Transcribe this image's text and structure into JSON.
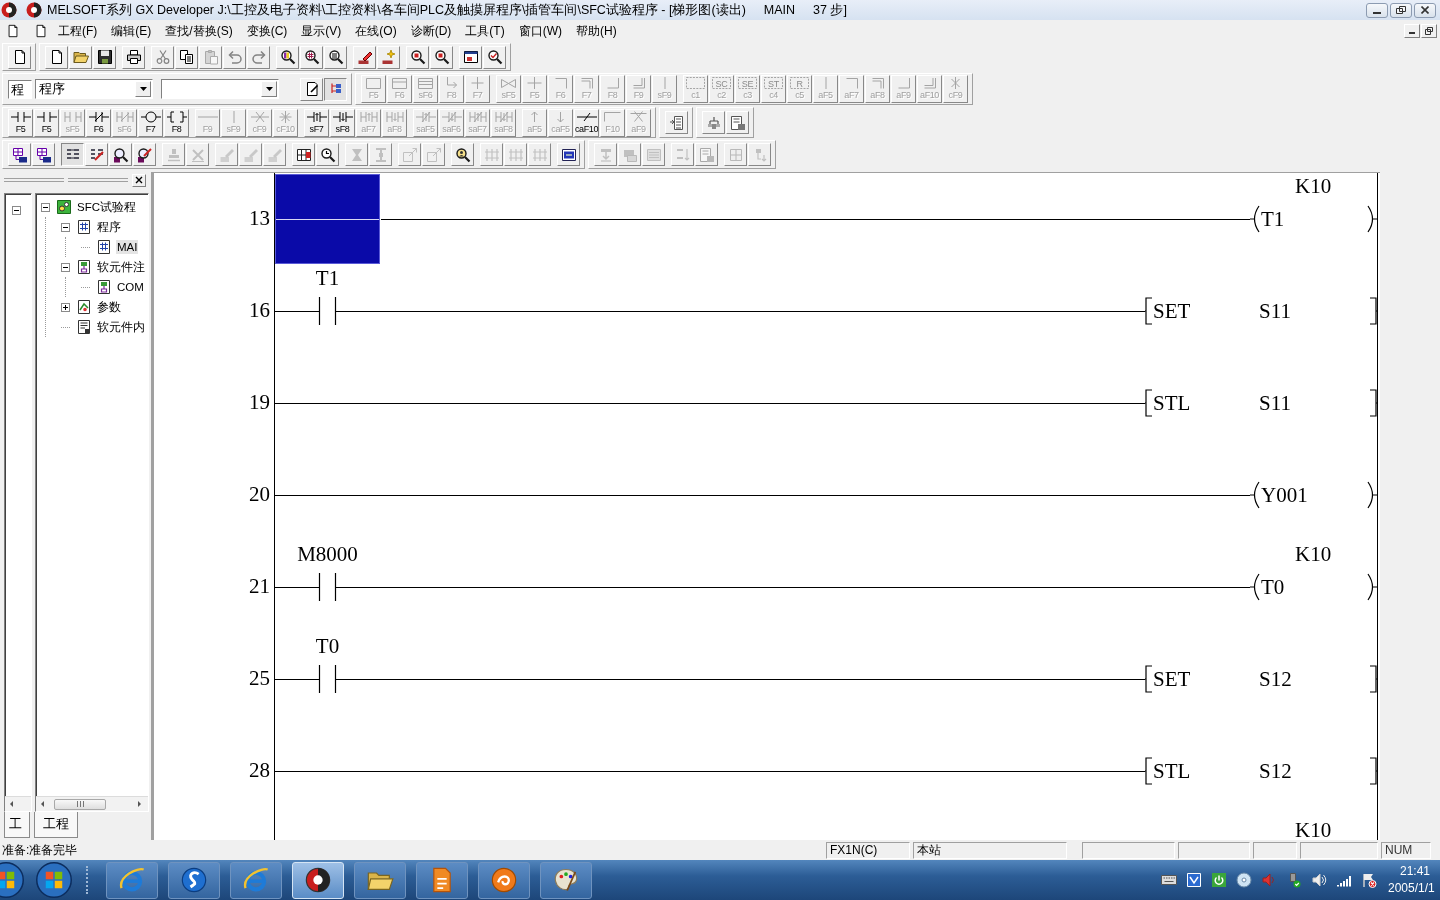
{
  "window": {
    "title": "MELSOFT系列 GX Developer J:\\工控及电子资料\\工控资料\\各车间PLC及触摸屏程序\\插管车间\\SFC试验程序 - [梯形图(读出)",
    "program": "MAIN",
    "steps": "37 步]"
  },
  "menu": [
    "工程(F)",
    "编辑(E)",
    "查找/替换(S)",
    "变换(C)",
    "显示(V)",
    "在线(O)",
    "诊断(D)",
    "工具(T)",
    "窗口(W)",
    "帮助(H)"
  ],
  "standard_toolbar": [
    [
      [
        {
          "kind": "tool",
          "disabled": false
        }
      ]
    ],
    [
      [
        {
          "kind": "tool",
          "disabled": false
        },
        {
          "kind": "tool",
          "disabled": false
        },
        {
          "kind": "tool",
          "disabled": false
        }
      ],
      [
        {
          "kind": "tool",
          "disabled": false
        }
      ],
      [
        {
          "kind": "tool",
          "disabled": true
        },
        {
          "kind": "tool",
          "disabled": false
        },
        {
          "kind": "tool",
          "disabled": true
        },
        {
          "kind": "tool",
          "disabled": true
        },
        {
          "kind": "tool",
          "disabled": true
        }
      ],
      [
        {
          "kind": "tool",
          "disabled": false
        },
        {
          "kind": "tool",
          "disabled": false
        },
        {
          "kind": "tool",
          "disabled": false
        }
      ],
      [
        {
          "kind": "tool",
          "disabled": false
        },
        {
          "kind": "tool",
          "disabled": false
        }
      ],
      [
        {
          "kind": "tool",
          "disabled": false
        },
        {
          "kind": "tool",
          "disabled": false
        }
      ],
      [
        {
          "kind": "tool",
          "disabled": false
        },
        {
          "kind": "tool",
          "disabled": false
        }
      ]
    ]
  ],
  "program_bar": {
    "label": "程",
    "value": "程序",
    "views": [
      {
        "kind": "tool",
        "disabled": false,
        "pressed": false
      },
      {
        "kind": "tool",
        "disabled": false,
        "pressed": true
      }
    ]
  },
  "sfc_toolbar": [
    [
      [
        {
          "kind": "key",
          "key": "F5",
          "disabled": true
        },
        {
          "kind": "key",
          "key": "F6",
          "disabled": true
        },
        {
          "kind": "key",
          "key": "sF6",
          "disabled": true
        },
        {
          "kind": "key",
          "key": "F8",
          "disabled": true
        },
        {
          "kind": "key",
          "key": "F7",
          "disabled": true
        }
      ],
      [
        {
          "kind": "key",
          "key": "sF5",
          "disabled": true
        },
        {
          "kind": "key",
          "key": "F5",
          "disabled": true
        },
        {
          "kind": "key",
          "key": "F6",
          "disabled": true
        },
        {
          "kind": "key",
          "key": "F7",
          "disabled": true
        },
        {
          "kind": "key",
          "key": "F8",
          "disabled": true
        },
        {
          "kind": "key",
          "key": "F9",
          "disabled": true
        },
        {
          "kind": "key",
          "key": "sF9",
          "disabled": true
        }
      ],
      [
        {
          "kind": "key",
          "key": "c1",
          "disabled": true
        },
        {
          "kind": "key",
          "tag": "SC",
          "key": "c2",
          "disabled": true
        },
        {
          "kind": "key",
          "tag": "SE",
          "key": "c3",
          "disabled": true
        },
        {
          "kind": "key",
          "tag": "ST",
          "key": "c4",
          "disabled": true
        },
        {
          "kind": "key",
          "tag": "R",
          "key": "c5",
          "disabled": true
        },
        {
          "kind": "key",
          "key": "aF5",
          "disabled": true
        },
        {
          "kind": "key",
          "key": "aF7",
          "disabled": true
        },
        {
          "kind": "key",
          "key": "aF8",
          "disabled": true
        },
        {
          "kind": "key",
          "key": "aF9",
          "disabled": true
        },
        {
          "kind": "key",
          "key": "aF10",
          "disabled": true
        },
        {
          "kind": "key",
          "key": "cF9",
          "disabled": true
        }
      ]
    ]
  ],
  "ladder_toolbar": [
    [
      [
        {
          "kind": "key",
          "key": "F5",
          "disabled": false
        },
        {
          "kind": "key",
          "key": "F5",
          "disabled": false
        },
        {
          "kind": "key",
          "key": "sF5",
          "disabled": true
        },
        {
          "kind": "key",
          "key": "F6",
          "disabled": false
        },
        {
          "kind": "key",
          "key": "sF6",
          "disabled": true
        },
        {
          "kind": "key",
          "key": "F7",
          "disabled": false
        },
        {
          "kind": "key",
          "key": "F8",
          "disabled": false
        }
      ],
      [
        {
          "kind": "key",
          "key": "F9",
          "disabled": true
        },
        {
          "kind": "key",
          "key": "sF9",
          "disabled": true
        },
        {
          "kind": "key",
          "key": "cF9",
          "disabled": true
        },
        {
          "kind": "key",
          "key": "cF10",
          "disabled": true
        }
      ],
      [
        {
          "kind": "key",
          "key": "sF7",
          "disabled": false
        },
        {
          "kind": "key",
          "key": "sF8",
          "disabled": false
        },
        {
          "kind": "key",
          "key": "aF7",
          "disabled": true
        },
        {
          "kind": "key",
          "key": "aF8",
          "disabled": true
        }
      ],
      [
        {
          "kind": "key",
          "key": "saF5",
          "disabled": true
        },
        {
          "kind": "key",
          "key": "saF6",
          "disabled": true
        },
        {
          "kind": "key",
          "key": "saF7",
          "disabled": true
        },
        {
          "kind": "key",
          "key": "saF8",
          "disabled": true
        }
      ],
      [
        {
          "kind": "key",
          "key": "aF5",
          "disabled": true
        },
        {
          "kind": "key",
          "key": "caF5",
          "disabled": true
        },
        {
          "kind": "key",
          "key": "caF10",
          "disabled": false
        },
        {
          "kind": "key",
          "key": "F10",
          "disabled": true
        },
        {
          "kind": "key",
          "key": "aF9",
          "disabled": true
        }
      ]
    ],
    [
      [
        {
          "kind": "tool",
          "disabled": false
        }
      ]
    ],
    [
      [
        {
          "kind": "tool",
          "disabled": false
        },
        {
          "kind": "tool",
          "disabled": false
        }
      ]
    ]
  ],
  "tool_toolbar": [
    [
      [
        {
          "kind": "tool",
          "disabled": false,
          "pressed": false
        },
        {
          "kind": "tool",
          "disabled": false,
          "pressed": false
        }
      ],
      [
        {
          "kind": "tool",
          "disabled": false,
          "pressed": true
        },
        {
          "kind": "tool",
          "disabled": false,
          "pressed": false
        },
        {
          "kind": "tool",
          "disabled": false,
          "pressed": false
        },
        {
          "kind": "tool",
          "disabled": false,
          "pressed": false
        }
      ],
      [
        {
          "kind": "tool",
          "disabled": true,
          "pressed": false
        },
        {
          "kind": "tool",
          "disabled": true,
          "pressed": false
        }
      ],
      [
        {
          "kind": "tool",
          "disabled": true,
          "pressed": false
        },
        {
          "kind": "tool",
          "disabled": true,
          "pressed": false
        },
        {
          "kind": "tool",
          "disabled": true,
          "pressed": false
        }
      ],
      [
        {
          "kind": "tool",
          "disabled": false,
          "pressed": false
        },
        {
          "kind": "tool",
          "disabled": false,
          "pressed": false
        }
      ],
      [
        {
          "kind": "tool",
          "disabled": true,
          "pressed": false
        },
        {
          "kind": "tool",
          "disabled": true,
          "pressed": false
        }
      ],
      [
        {
          "kind": "tool",
          "disabled": true,
          "pressed": false
        },
        {
          "kind": "tool",
          "disabled": true,
          "pressed": false
        }
      ],
      [
        {
          "kind": "tool",
          "disabled": false,
          "pressed": false
        }
      ],
      [
        {
          "kind": "tool",
          "disabled": true,
          "pressed": false
        },
        {
          "kind": "tool",
          "disabled": true,
          "pressed": false
        },
        {
          "kind": "tool",
          "disabled": true,
          "pressed": false
        }
      ],
      [
        {
          "kind": "tool",
          "disabled": false,
          "pressed": false
        }
      ]
    ],
    [
      [
        {
          "kind": "tool",
          "disabled": true,
          "pressed": false
        },
        {
          "kind": "tool",
          "disabled": true,
          "pressed": false
        },
        {
          "kind": "tool",
          "disabled": true,
          "pressed": false
        }
      ],
      [
        {
          "kind": "tool",
          "disabled": true,
          "pressed": false
        },
        {
          "kind": "tool",
          "disabled": true,
          "pressed": false
        }
      ],
      [
        {
          "kind": "tool",
          "disabled": true,
          "pressed": false
        },
        {
          "kind": "tool",
          "disabled": true,
          "pressed": false
        }
      ]
    ]
  ],
  "project": {
    "mini_pane": {
      "expanded": true,
      "tab": "工"
    },
    "tab": "工程",
    "tree": [
      {
        "label": "SFC试验程",
        "expanded": true,
        "selected": false,
        "children": [
          {
            "label": "程序",
            "expanded": true,
            "selected": false,
            "children": [
              {
                "label": "MAI",
                "selected": true
              }
            ]
          },
          {
            "label": "软元件注",
            "expanded": true,
            "selected": false,
            "children": [
              {
                "label": "COM",
                "selected": false
              }
            ]
          },
          {
            "label": "参数",
            "expanded": false,
            "selected": false
          },
          {
            "label": "软元件内",
            "selected": false
          }
        ]
      }
    ]
  },
  "ladder": {
    "rungs": [
      {
        "step": "13",
        "selected": true,
        "output": {
          "kind": "coil",
          "operand": "T1",
          "constant": "K10"
        }
      },
      {
        "step": "16",
        "selected": false,
        "contact": {
          "kind": "open",
          "device": "T1"
        },
        "output": {
          "kind": "instruction",
          "name": "SET",
          "operand": "S11"
        }
      },
      {
        "step": "19",
        "selected": false,
        "output": {
          "kind": "instruction",
          "name": "STL",
          "operand": "S11"
        }
      },
      {
        "step": "20",
        "selected": false,
        "output": {
          "kind": "coil",
          "operand": "Y001"
        }
      },
      {
        "step": "21",
        "selected": false,
        "contact": {
          "kind": "open",
          "device": "M8000"
        },
        "output": {
          "kind": "coil",
          "operand": "T0",
          "constant": "K10"
        }
      },
      {
        "step": "25",
        "selected": false,
        "contact": {
          "kind": "open",
          "device": "T0"
        },
        "output": {
          "kind": "instruction",
          "name": "SET",
          "operand": "S12"
        }
      },
      {
        "step": "28",
        "selected": false,
        "output": {
          "kind": "instruction",
          "name": "STL",
          "operand": "S12"
        }
      }
    ],
    "next_rung": {
      "constant": "K10"
    }
  },
  "status_bar": {
    "message": "准备:准备完毕",
    "plc": "FX1N(C)",
    "station": "本站",
    "num": "NUM"
  },
  "taskbar": {
    "apps": [
      {
        "selected": false
      },
      {
        "selected": false
      },
      {
        "selected": false
      },
      {
        "selected": true
      },
      {
        "selected": false
      },
      {
        "selected": false
      },
      {
        "selected": false
      },
      {
        "selected": false
      }
    ],
    "time": "21:41",
    "date": "2005/1/1"
  }
}
